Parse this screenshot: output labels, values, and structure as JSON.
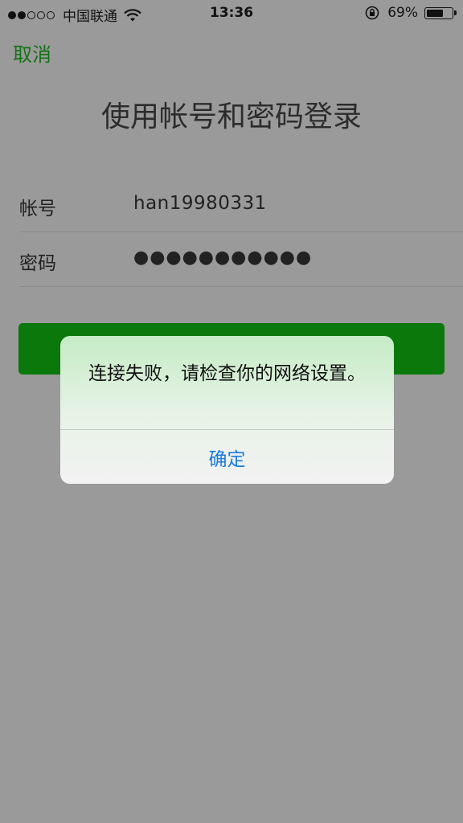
{
  "status_bar": {
    "carrier": "中国联通",
    "time": "13:36",
    "battery_percent": "69%",
    "battery_level": 0.69,
    "signal_strength": 2,
    "signal_total": 5
  },
  "login": {
    "cancel_label": "取消",
    "title": "使用帐号和密码登录",
    "account_label": "帐号",
    "account_value": "han19980331",
    "password_label": "密码",
    "password_value": "●●●●●●●●●●●",
    "accent_color": "#0b780b"
  },
  "alert": {
    "message": "连接失败，请检查你的网络设置。",
    "ok_label": "确定",
    "button_color": "#1a7ae0"
  }
}
